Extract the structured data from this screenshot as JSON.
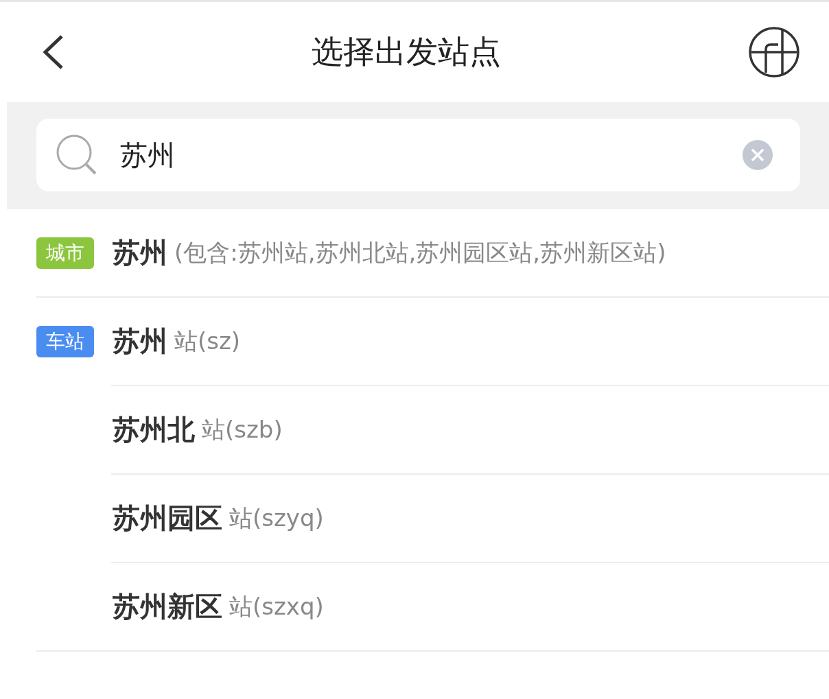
{
  "header": {
    "title": "选择出发站点"
  },
  "search": {
    "value": "苏州"
  },
  "results": [
    {
      "tag": "城市",
      "color": "#8cc63f",
      "items": [
        {
          "name": "苏州",
          "detail": "(包含:苏州站,苏州北站,苏州园区站,苏州新区站)"
        }
      ]
    },
    {
      "tag": "车站",
      "color": "#4a8cf0",
      "items": [
        {
          "name": "苏州",
          "detail": "站(sz)"
        },
        {
          "name": "苏州北",
          "detail": "站(szb)"
        },
        {
          "name": "苏州园区",
          "detail": "站(szyq)"
        },
        {
          "name": "苏州新区",
          "detail": "站(szxq)"
        }
      ]
    }
  ]
}
